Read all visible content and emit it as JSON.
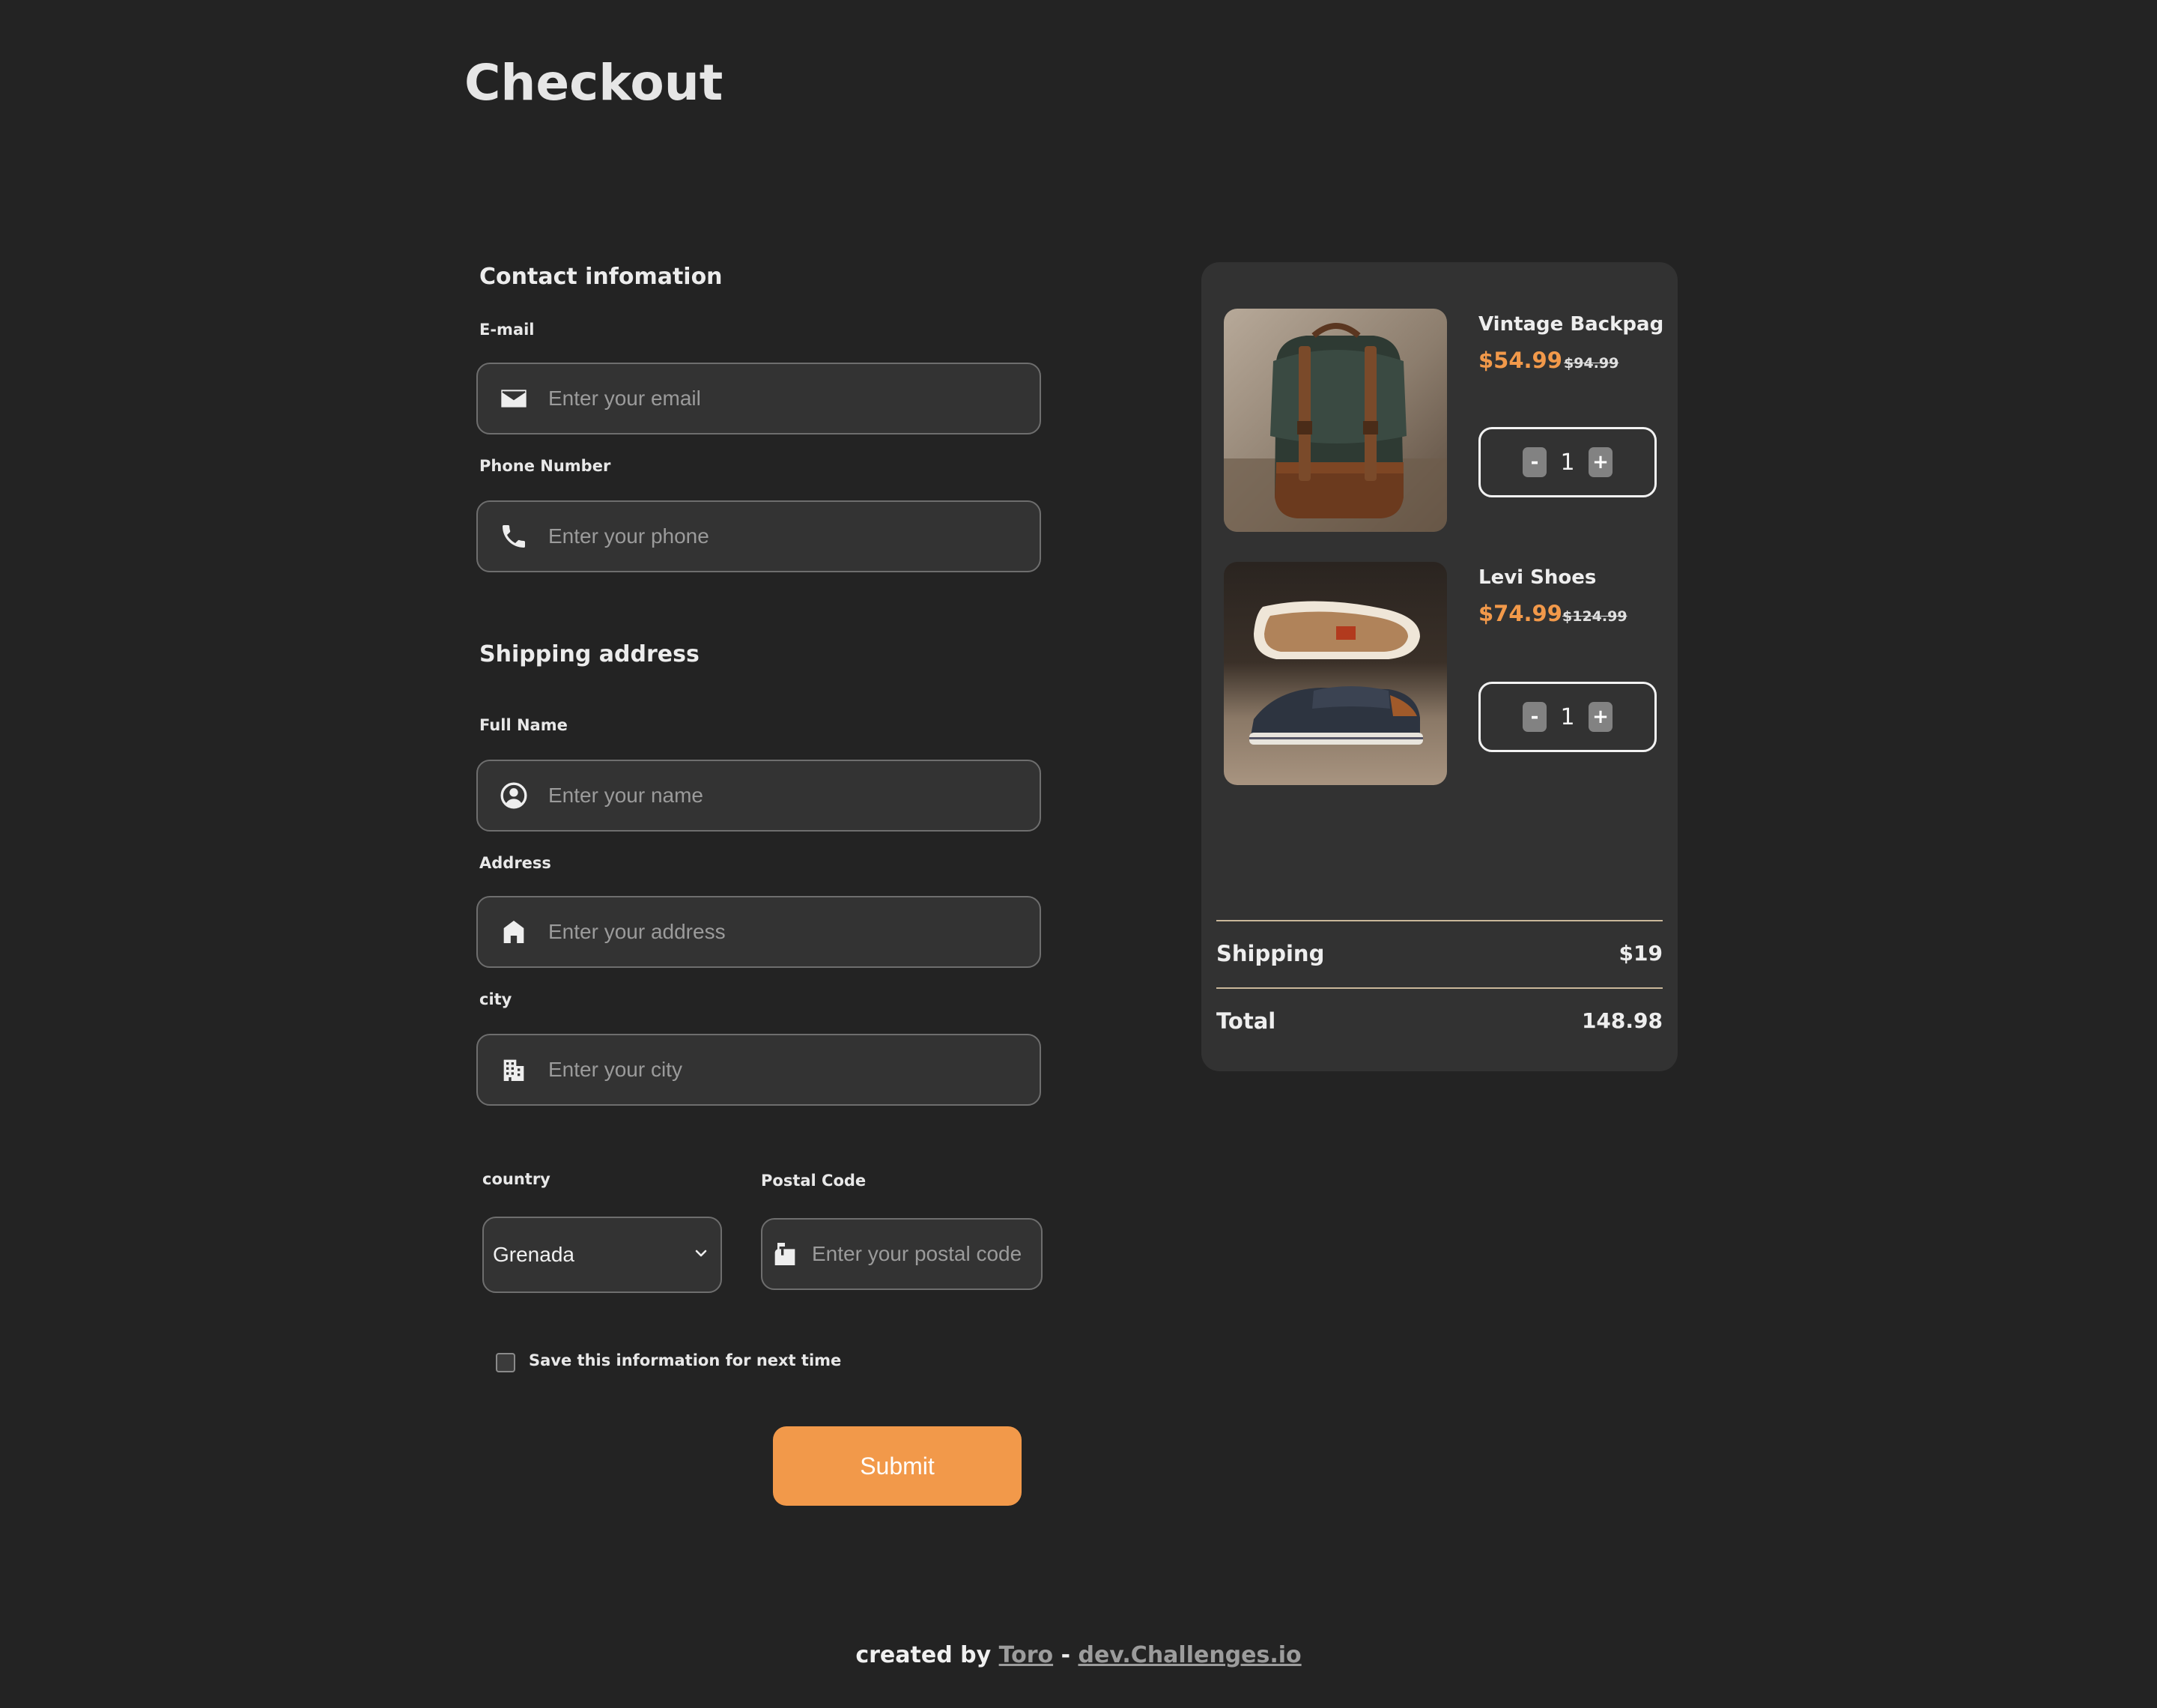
{
  "page": {
    "title": "Checkout"
  },
  "contact": {
    "title": "Contact infomation",
    "email": {
      "label": "E-mail",
      "placeholder": "Enter your email",
      "icon": "envelope-icon"
    },
    "phone": {
      "label": "Phone Number",
      "placeholder": "Enter your phone",
      "icon": "phone-icon"
    }
  },
  "shipping": {
    "title": "Shipping address",
    "full_name": {
      "label": "Full Name",
      "placeholder": "Enter your name",
      "icon": "user-circle-icon"
    },
    "address": {
      "label": "Address",
      "placeholder": "Enter your address",
      "icon": "home-icon"
    },
    "city": {
      "label": "city",
      "placeholder": "Enter your city",
      "icon": "building-icon"
    },
    "country": {
      "label": "country",
      "selected": "Grenada",
      "icon": "chevron-down-icon"
    },
    "postal": {
      "label": "Postal Code",
      "placeholder": "Enter your postal code",
      "icon": "mailbox-icon"
    },
    "save_label": "Save this information for next time",
    "save_checked": false,
    "submit_label": "Submit"
  },
  "cart": {
    "items": [
      {
        "name": "Vintage Backpag",
        "price": "$54.99",
        "old_price": "$94.99",
        "qty": "1",
        "minus": "-",
        "plus": "+"
      },
      {
        "name": "Levi Shoes",
        "price": "$74.99",
        "old_price": "$124.99",
        "qty": "1",
        "minus": "-",
        "plus": "+"
      }
    ],
    "shipping_label": "Shipping",
    "shipping_value": "$19",
    "total_label": "Total",
    "total_value": "148.98"
  },
  "footer": {
    "prefix": "created by",
    "author": "Toro",
    "separator": "-",
    "site": "dev.Challenges.io"
  },
  "colors": {
    "background": "#232323",
    "panel": "#323232",
    "accent": "#f2994a",
    "field_bg": "#333333",
    "divider": "#c9b79a"
  }
}
